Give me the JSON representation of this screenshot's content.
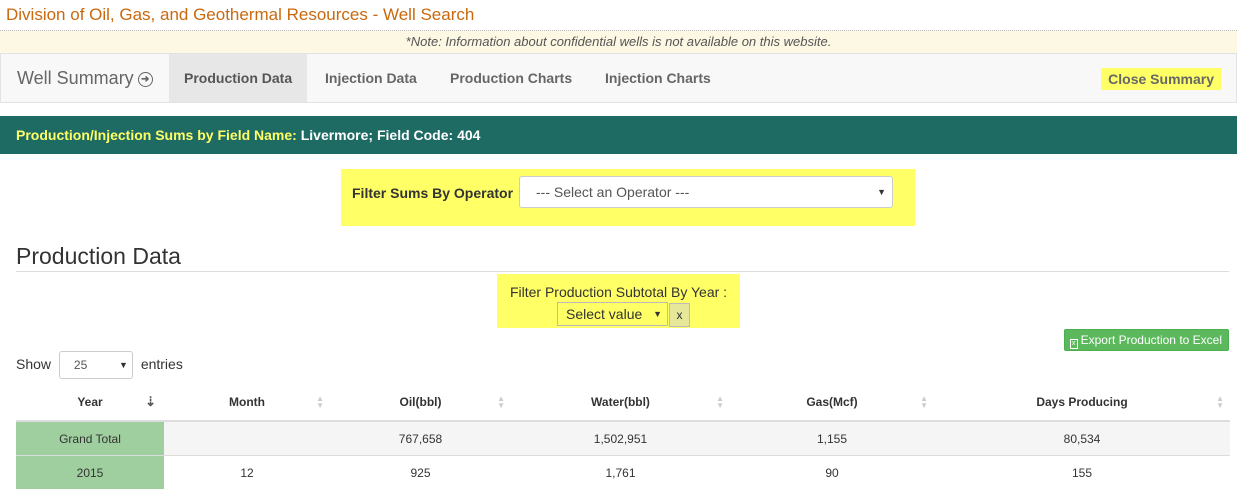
{
  "site": {
    "title": "Division of Oil, Gas, and Geothermal Resources - Well Search",
    "notice": "*Note: Information about confidential wells is not available on this website."
  },
  "nav": {
    "brand": "Well Summary",
    "tabs": [
      "Production Data",
      "Injection Data",
      "Production Charts",
      "Injection Charts"
    ],
    "active_tab": "Production Data",
    "close_label": "Close Summary"
  },
  "panel": {
    "heading_label": "Production/Injection Sums by Field Name:",
    "heading_value": " Livermore; Field Code: 404"
  },
  "operator_filter": {
    "label": "Filter Sums By Operator",
    "selected": "--- Select an Operator ---"
  },
  "production": {
    "title": "Production Data",
    "year_filter_label": "Filter Production Subtotal By Year :",
    "year_select": "Select value",
    "clear_label": "x",
    "export_label": "Export Production to Excel",
    "show_label": "Show",
    "page_length": "25",
    "entries_label": "entries",
    "columns": [
      "Year",
      "Month",
      "Oil(bbl)",
      "Water(bbl)",
      "Gas(Mcf)",
      "Days Producing"
    ],
    "rows": [
      [
        "Grand Total",
        "",
        "767,658",
        "1,502,951",
        "1,155",
        "80,534"
      ],
      [
        "2015",
        "12",
        "925",
        "1,761",
        "90",
        "155"
      ]
    ]
  },
  "colors": {
    "highlight": "#ffff66",
    "panel_header": "#1e6b64",
    "title_orange": "#c9690f",
    "year_cell": "#9fcf9f",
    "excel_button": "#5cb85c"
  }
}
